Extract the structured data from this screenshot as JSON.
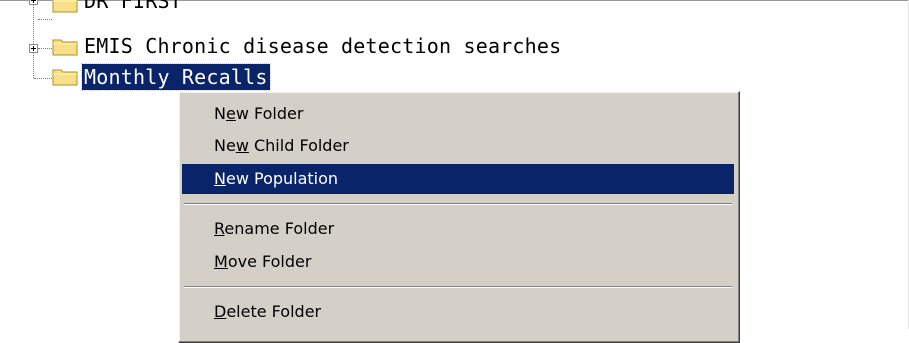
{
  "tree": {
    "items": [
      {
        "label": "DR FIRST",
        "expandable": true,
        "selected": false
      },
      {
        "label": "EMIS Chronic disease detection searches",
        "expandable": true,
        "selected": false
      },
      {
        "label": "Monthly Recalls",
        "expandable": false,
        "selected": true
      }
    ]
  },
  "context_menu": {
    "items": [
      {
        "label": "New Folder",
        "accel_index": 1,
        "highlighted": false
      },
      {
        "label": "New Child Folder",
        "accel_index": 2,
        "highlighted": false
      },
      {
        "label": "New Population",
        "accel_index": 0,
        "highlighted": true
      },
      {
        "label": "Rename Folder",
        "accel_index": 0,
        "highlighted": false
      },
      {
        "label": "Move Folder",
        "accel_index": 0,
        "highlighted": false
      },
      {
        "label": "Delete Folder",
        "accel_index": 0,
        "highlighted": false
      }
    ]
  },
  "colors": {
    "selection": "#0a246a",
    "menu_face": "#d4d0c8",
    "folder_fill": "#f8e08a",
    "folder_stroke": "#b0901c"
  }
}
